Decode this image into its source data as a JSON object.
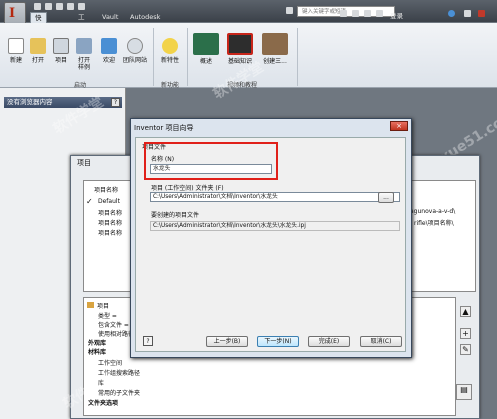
{
  "app": {
    "logo": "I",
    "search_placeholder": "键入关键字或短语",
    "login": "登录"
  },
  "tabs": [
    "快速入门",
    "工具",
    "Vault",
    "Autodesk 360"
  ],
  "ribbon": {
    "buttons": [
      "新建",
      "打开",
      "项目",
      "打开\n样例",
      "欢迎",
      "团队网站",
      "新特性",
      "概述",
      "基础知识",
      "创建三..."
    ],
    "groups": [
      "启动",
      "新功能",
      "视频和教程"
    ]
  },
  "browser": {
    "header": "没有浏览器内容",
    "help": "?"
  },
  "project_dialog": {
    "title": "项目",
    "col_name": "项目名称",
    "rows": [
      "Default",
      "项目名称",
      "项目名称",
      "项目名称"
    ],
    "right_frag1": "agunova-a-v-d\\",
    "right_frag2": "rifle\\项目名称\\",
    "tree": {
      "root": "项目",
      "items": [
        "类型 = ",
        "包含文件 = ",
        "使用相对路径",
        "外观库",
        "材料库",
        "工作空间",
        "工作组搜索路径",
        "库",
        "常用的子文件夹",
        "文件夹选项"
      ]
    }
  },
  "wizard": {
    "title": "Inventor 项目向导",
    "close": "×",
    "section": "项目文件",
    "name_label": "名称 (N)",
    "name_value": "水龙头",
    "folder_label": "项目 (工作空间) 文件夹 (F)",
    "folder_value": "C:\\Users\\Administrator\\文档\\Inventor\\水龙头",
    "browse": "...",
    "file_label": "要创建的项目文件",
    "file_value": "C:\\Users\\Administrator\\文档\\Inventor\\水龙头\\水龙头.ipj",
    "help": "?",
    "buttons": {
      "prev": "上一步(B)",
      "next": "下一步(N)",
      "finish": "完成(E)",
      "cancel": "取消(C)"
    }
  },
  "watermarks": [
    "软件学堂",
    "软件学堂",
    "www.xue51.com",
    "软件学堂"
  ]
}
